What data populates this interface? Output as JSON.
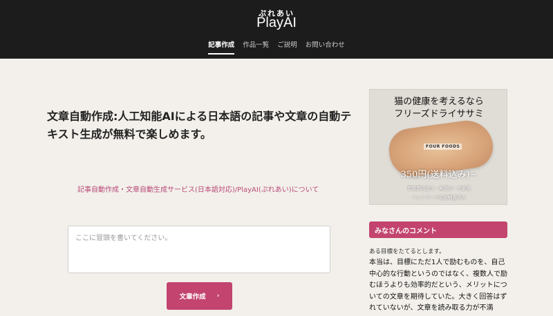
{
  "header": {
    "logo_kana": "ぷれあい",
    "logo_text": "PlayAI",
    "nav": [
      {
        "label": "記事作成",
        "active": true
      },
      {
        "label": "作品一覧",
        "active": false
      },
      {
        "label": "ご説明",
        "active": false
      },
      {
        "label": "お問い合わせ",
        "active": false
      }
    ]
  },
  "main": {
    "title": "文章自動作成:人工知能AIによる日本語の記事や文章の自動テキスト生成が無料で楽しめます。",
    "about_link": "記事自動作成・文章自動生成サービス(日本語対応)/PlayAI(ぷれあい)について",
    "prompt_placeholder": "ここに冒頭を書いてください。",
    "generate_button": "文章作成"
  },
  "sidebar": {
    "ad": {
      "line1": "猫の健康を考えるなら",
      "line2": "フリーズドライササミ",
      "brand": "FOUR FOODS",
      "price": "350円(送料込み)~",
      "sub1": "国産国内加工・無添加・犬猫用",
      "sub2": "ペットフード安全検査済み"
    },
    "comments": {
      "header": "みなさんのコメント",
      "lead": "ある目標をたてるとします。",
      "body": "本当は、目標にただ1人で励むものを、自己中心的な行動というのではなく、複数人で励むほうよりも効率的だという、メリットについての文章を期待していた。大きく回答はずれていないが、文章を読み取る力が不満"
    }
  },
  "colors": {
    "header_bg": "#1c1c1c",
    "page_bg": "#f3f0eb",
    "accent": "#c2446f",
    "link": "#b84a78"
  }
}
